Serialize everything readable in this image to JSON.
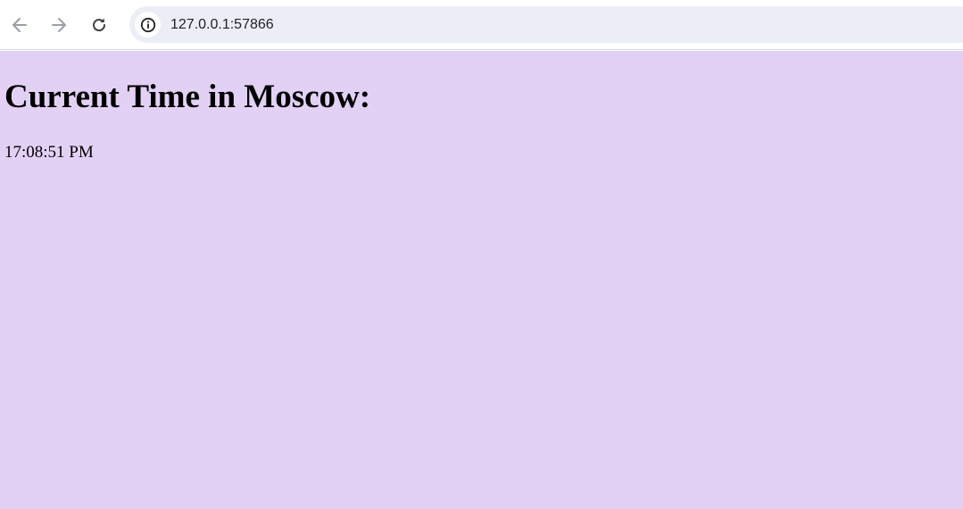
{
  "browser": {
    "url": "127.0.0.1:57866",
    "icons": {
      "back": "arrow-left-icon",
      "forward": "arrow-right-icon",
      "reload": "reload-icon",
      "site_info": "info-icon"
    }
  },
  "page": {
    "title": "Current Time in Moscow:",
    "time": "17:08:51 PM",
    "background_color": "#e3d1f5"
  }
}
